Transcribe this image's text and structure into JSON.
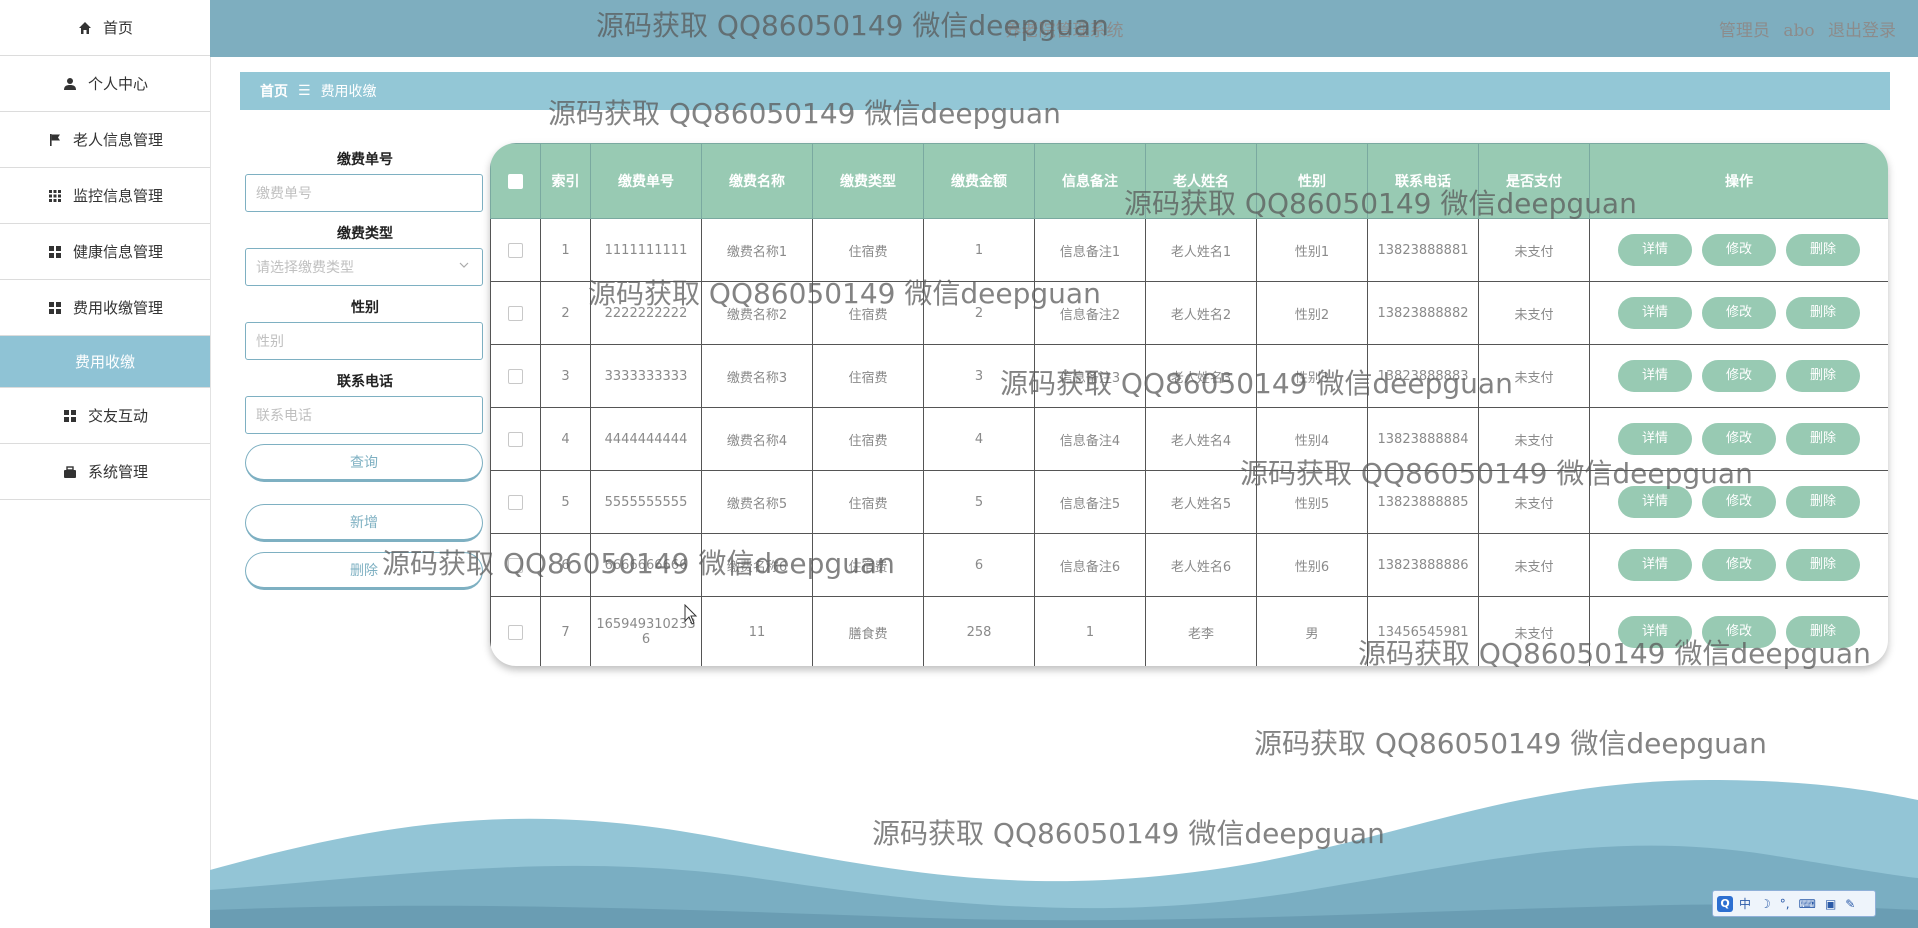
{
  "sidebar": {
    "items": [
      {
        "label": "首页",
        "icon": "home-icon"
      },
      {
        "label": "个人中心",
        "icon": "user-icon"
      },
      {
        "label": "老人信息管理",
        "icon": "flag-icon"
      },
      {
        "label": "监控信息管理",
        "icon": "grid-icon"
      },
      {
        "label": "健康信息管理",
        "icon": "apps-icon"
      },
      {
        "label": "费用收缴管理",
        "icon": "apps-icon"
      },
      {
        "label": "费用收缴",
        "icon": ""
      },
      {
        "label": "交友互动",
        "icon": "apps-icon"
      },
      {
        "label": "系统管理",
        "icon": "briefcase-icon"
      }
    ]
  },
  "header": {
    "title": "养老院管理系统",
    "role": "管理员",
    "username": "abo",
    "logout": "退出登录",
    "bg_color": "#7eaebf"
  },
  "breadcrumb": {
    "home": "首页",
    "separator": "☰",
    "current": "费用收缴"
  },
  "search": {
    "fields": [
      {
        "label": "缴费单号",
        "placeholder": "缴费单号"
      },
      {
        "label": "缴费类型",
        "placeholder": "请选择缴费类型"
      },
      {
        "label": "性别",
        "placeholder": "性别"
      },
      {
        "label": "联系电话",
        "placeholder": "联系电话"
      }
    ],
    "query_button": "查询",
    "add_button": "新增",
    "delete_button": "删除"
  },
  "table": {
    "columns": [
      "索引",
      "缴费单号",
      "缴费名称",
      "缴费类型",
      "缴费金额",
      "信息备注",
      "老人姓名",
      "性别",
      "联系电话",
      "是否支付",
      "操作"
    ],
    "header_color": "#98cab3",
    "rows": [
      [
        "1",
        "1111111111",
        "缴费名称1",
        "住宿费",
        "1",
        "信息备注1",
        "老人姓名1",
        "性别1",
        "13823888881",
        "未支付"
      ],
      [
        "2",
        "2222222222",
        "缴费名称2",
        "住宿费",
        "2",
        "信息备注2",
        "老人姓名2",
        "性别2",
        "13823888882",
        "未支付"
      ],
      [
        "3",
        "3333333333",
        "缴费名称3",
        "住宿费",
        "3",
        "信息备注3",
        "老人姓名3",
        "性别3",
        "13823888883",
        "未支付"
      ],
      [
        "4",
        "4444444444",
        "缴费名称4",
        "住宿费",
        "4",
        "信息备注4",
        "老人姓名4",
        "性别4",
        "13823888884",
        "未支付"
      ],
      [
        "5",
        "5555555555",
        "缴费名称5",
        "住宿费",
        "5",
        "信息备注5",
        "老人姓名5",
        "性别5",
        "13823888885",
        "未支付"
      ],
      [
        "6",
        "6666666666",
        "缴费名称6",
        "住宿费",
        "6",
        "信息备注6",
        "老人姓名6",
        "性别6",
        "13823888886",
        "未支付"
      ],
      [
        "7",
        "1659493102336",
        "11",
        "膳食费",
        "258",
        "1",
        "老李",
        "男",
        "13456545981",
        "未支付"
      ]
    ],
    "actions": {
      "detail": "详情",
      "edit": "修改",
      "delete": "删除"
    }
  },
  "watermark": {
    "text": "源码获取 QQ86050149 微信deepguan"
  },
  "ime": {
    "mode": "中"
  }
}
